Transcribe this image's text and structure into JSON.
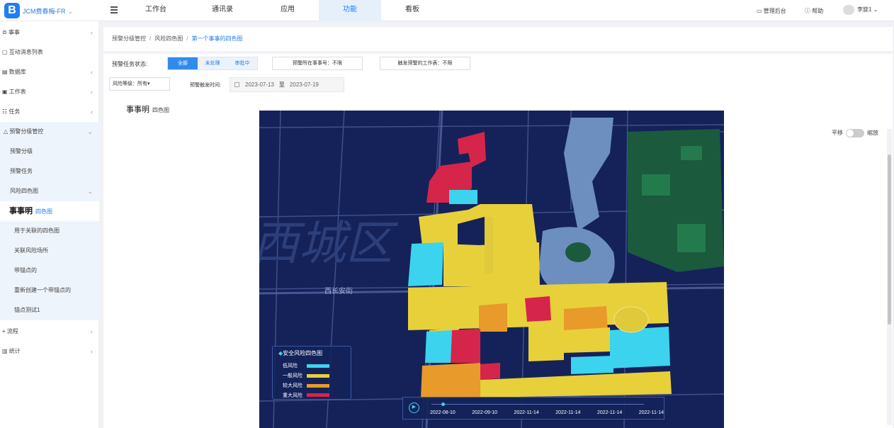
{
  "header": {
    "org": "JCM费春梅-FR",
    "nav": [
      "工作台",
      "通讯录",
      "应用",
      "功能",
      "看板"
    ],
    "active_nav": "功能",
    "tools": {
      "admin": "管理后台",
      "help": "帮助",
      "user": "李旋1"
    }
  },
  "sidebar": {
    "items": [
      {
        "label": "事事",
        "caret": "‹"
      },
      {
        "label": "互动消息列表",
        "caret": ""
      },
      {
        "label": "数据库",
        "caret": "‹"
      },
      {
        "label": "工作表",
        "caret": "‹"
      },
      {
        "label": "任务",
        "caret": "‹"
      },
      {
        "label": "预警分级管控",
        "caret": "⌄"
      },
      {
        "label": "预警分级",
        "caret": ""
      },
      {
        "label": "预警任务",
        "caret": ""
      },
      {
        "label": "风险四色图",
        "caret": "⌄"
      },
      {
        "label_big": "事事明",
        "label_small": "四色图"
      },
      {
        "label": "用于关联的四色图",
        "caret": ""
      },
      {
        "label": "关联风险场所",
        "caret": ""
      },
      {
        "label": "带锚点的",
        "caret": ""
      },
      {
        "label": "重新创建一个带锚点的",
        "caret": ""
      },
      {
        "label": "锚点测试1",
        "caret": ""
      },
      {
        "label": "流程",
        "caret": "‹"
      },
      {
        "label": "统计",
        "caret": "‹"
      }
    ]
  },
  "breadcrumb": {
    "items": [
      "预警分级管控",
      "风险四色图"
    ],
    "current": "第一个事事的四色图"
  },
  "filters": {
    "status_label": "预警任务状态:",
    "status_options": [
      "全部",
      "未处理",
      "审批中"
    ],
    "status_selected": "全部",
    "event_no": "预警所在事事号：不限",
    "worksheet": "触发预警的工作表：不限",
    "level_label": "风险等级：所有",
    "time_label": "预警触发时间:",
    "date_from": "2023-07-13",
    "date_sep": "至",
    "date_to": "2023-07-19"
  },
  "map_title": {
    "name": "事事明",
    "sub": "四色图"
  },
  "map": {
    "district": "西城区",
    "road_label": "西长安街",
    "legend": {
      "title": "安全风险四色图",
      "items": [
        {
          "label": "低风险",
          "color": "#3cd3ee"
        },
        {
          "label": "一般风险",
          "color": "#e8d03a"
        },
        {
          "label": "较大风险",
          "color": "#e89a2a"
        },
        {
          "label": "重大风险",
          "color": "#d6254a"
        }
      ]
    },
    "timeline": [
      "2022-08-10",
      "2022-09-10",
      "2022-11-14",
      "2022-11-14",
      "2022-11-14",
      "2022-11-14"
    ]
  },
  "view_toggle": {
    "left": "平移",
    "right": "缩放"
  }
}
